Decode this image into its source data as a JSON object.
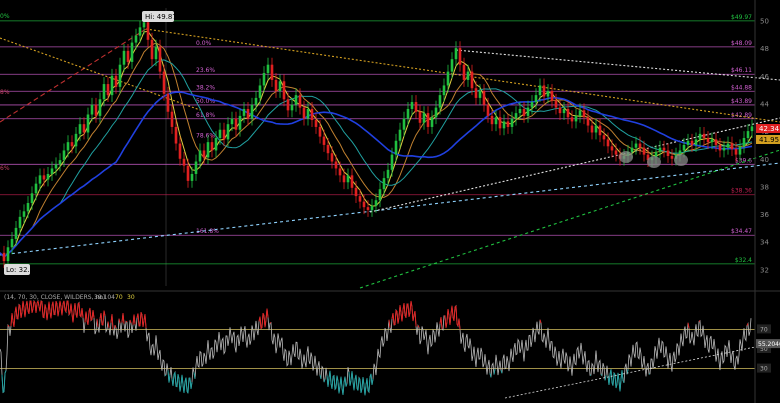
{
  "chart_data": {
    "type": "line",
    "price_panel": {
      "ylim": [
        30.8,
        50.9
      ],
      "y_ticks": [
        "50",
        "48",
        "46",
        "44",
        "42",
        "40",
        "38",
        "36",
        "34",
        "32"
      ],
      "high_label": "Hi: 49.87",
      "low_label": "Lo: 32.53",
      "last_price": "42.34",
      "last_price_2": "41.95",
      "left_pct_labels": [
        "0%",
        "8%",
        "6%"
      ],
      "horizontal_levels": [
        {
          "value": 49.97,
          "label": "$49.97",
          "color": "#20c040"
        },
        {
          "value": 48.09,
          "label": "$48.09",
          "color": "#d060d0"
        },
        {
          "value": 46.11,
          "label": "$46.11",
          "color": "#d060d0"
        },
        {
          "value": 44.88,
          "label": "$44.88",
          "color": "#d060d0"
        },
        {
          "value": 43.89,
          "label": "$43.89",
          "color": "#d060d0"
        },
        {
          "value": 42.89,
          "label": "$42.89",
          "color": "#d060d0"
        },
        {
          "value": 39.6,
          "label": "$39.6",
          "color": "#d060d0"
        },
        {
          "value": 37.4,
          "label": "$38.36",
          "color": "#c02050"
        },
        {
          "value": 34.47,
          "label": "$34.47",
          "color": "#d060d0"
        },
        {
          "value": 32.4,
          "label": "$32.4",
          "color": "#20c040"
        }
      ],
      "fib_labels": [
        {
          "value": 48.09,
          "label": "0.0%"
        },
        {
          "value": 46.11,
          "label": "23.6%"
        },
        {
          "value": 44.88,
          "label": "38.2%"
        },
        {
          "value": 43.89,
          "label": "50.0%"
        },
        {
          "value": 42.89,
          "label": "61.8%"
        },
        {
          "value": 41.4,
          "label": "78.6%"
        },
        {
          "value": 34.47,
          "label": "161.8%"
        }
      ],
      "price_series": [
        [
          0,
          33.2
        ],
        [
          4,
          32.6
        ],
        [
          8,
          33.6
        ],
        [
          12,
          34.2
        ],
        [
          16,
          35.0
        ],
        [
          20,
          35.8
        ],
        [
          24,
          36.2
        ],
        [
          28,
          36.8
        ],
        [
          32,
          37.5
        ],
        [
          36,
          38.2
        ],
        [
          40,
          38.8
        ],
        [
          44,
          38.5
        ],
        [
          48,
          38.9
        ],
        [
          52,
          39.3
        ],
        [
          56,
          39.6
        ],
        [
          60,
          39.9
        ],
        [
          64,
          40.6
        ],
        [
          68,
          41.2
        ],
        [
          72,
          40.9
        ],
        [
          76,
          41.8
        ],
        [
          80,
          42.5
        ],
        [
          84,
          41.9
        ],
        [
          88,
          43.2
        ],
        [
          92,
          43.9
        ],
        [
          96,
          43.1
        ],
        [
          100,
          44.3
        ],
        [
          104,
          45.4
        ],
        [
          108,
          44.6
        ],
        [
          112,
          46.0
        ],
        [
          116,
          45.2
        ],
        [
          120,
          46.8
        ],
        [
          124,
          47.8
        ],
        [
          128,
          47.0
        ],
        [
          132,
          48.4
        ],
        [
          136,
          48.9
        ],
        [
          140,
          49.5
        ],
        [
          144,
          49.87
        ],
        [
          148,
          48.6
        ],
        [
          152,
          47.2
        ],
        [
          156,
          48.1
        ],
        [
          160,
          46.3
        ],
        [
          164,
          44.7
        ],
        [
          168,
          43.4
        ],
        [
          172,
          42.3
        ],
        [
          176,
          41.1
        ],
        [
          180,
          40.0
        ],
        [
          184,
          39.5
        ],
        [
          188,
          38.4
        ],
        [
          192,
          38.9
        ],
        [
          196,
          39.8
        ],
        [
          200,
          40.6
        ],
        [
          204,
          40.1
        ],
        [
          208,
          41.2
        ],
        [
          212,
          40.6
        ],
        [
          216,
          41.5
        ],
        [
          220,
          42.1
        ],
        [
          224,
          41.4
        ],
        [
          228,
          42.5
        ],
        [
          232,
          42.9
        ],
        [
          236,
          42.1
        ],
        [
          240,
          43.1
        ],
        [
          244,
          43.6
        ],
        [
          248,
          42.9
        ],
        [
          252,
          43.9
        ],
        [
          256,
          44.4
        ],
        [
          260,
          45.3
        ],
        [
          264,
          46.2
        ],
        [
          268,
          46.8
        ],
        [
          272,
          45.7
        ],
        [
          276,
          44.9
        ],
        [
          280,
          45.6
        ],
        [
          284,
          44.3
        ],
        [
          288,
          43.5
        ],
        [
          292,
          43.9
        ],
        [
          296,
          44.6
        ],
        [
          300,
          43.7
        ],
        [
          304,
          42.9
        ],
        [
          308,
          43.6
        ],
        [
          312,
          42.8
        ],
        [
          316,
          42.3
        ],
        [
          320,
          41.6
        ],
        [
          324,
          41.0
        ],
        [
          328,
          40.4
        ],
        [
          332,
          39.8
        ],
        [
          336,
          39.3
        ],
        [
          340,
          38.8
        ],
        [
          344,
          38.3
        ],
        [
          348,
          38.8
        ],
        [
          352,
          37.9
        ],
        [
          356,
          37.3
        ],
        [
          360,
          36.9
        ],
        [
          364,
          36.5
        ],
        [
          368,
          36.3
        ],
        [
          372,
          36.6
        ],
        [
          376,
          37.0
        ],
        [
          380,
          37.8
        ],
        [
          384,
          38.6
        ],
        [
          388,
          39.2
        ],
        [
          392,
          40.3
        ],
        [
          396,
          41.3
        ],
        [
          400,
          42.1
        ],
        [
          404,
          42.9
        ],
        [
          408,
          43.6
        ],
        [
          412,
          44.1
        ],
        [
          416,
          43.4
        ],
        [
          420,
          42.6
        ],
        [
          424,
          43.3
        ],
        [
          428,
          42.3
        ],
        [
          432,
          43.0
        ],
        [
          436,
          43.7
        ],
        [
          440,
          44.6
        ],
        [
          444,
          45.3
        ],
        [
          448,
          46.3
        ],
        [
          452,
          47.2
        ],
        [
          456,
          48.0
        ],
        [
          460,
          46.8
        ],
        [
          464,
          45.7
        ],
        [
          468,
          46.3
        ],
        [
          472,
          45.1
        ],
        [
          476,
          44.4
        ],
        [
          480,
          44.9
        ],
        [
          484,
          43.9
        ],
        [
          488,
          43.1
        ],
        [
          492,
          42.5
        ],
        [
          496,
          43.0
        ],
        [
          500,
          42.2
        ],
        [
          504,
          42.7
        ],
        [
          508,
          42.3
        ],
        [
          512,
          42.9
        ],
        [
          516,
          43.3
        ],
        [
          520,
          43.6
        ],
        [
          524,
          43.1
        ],
        [
          528,
          43.7
        ],
        [
          532,
          44.1
        ],
        [
          536,
          44.6
        ],
        [
          540,
          45.3
        ],
        [
          544,
          44.5
        ],
        [
          548,
          44.9
        ],
        [
          552,
          44.2
        ],
        [
          556,
          43.7
        ],
        [
          560,
          43.3
        ],
        [
          564,
          43.6
        ],
        [
          568,
          43.0
        ],
        [
          572,
          42.7
        ],
        [
          576,
          43.1
        ],
        [
          580,
          43.5
        ],
        [
          584,
          43.0
        ],
        [
          588,
          42.4
        ],
        [
          592,
          41.9
        ],
        [
          596,
          42.4
        ],
        [
          600,
          41.7
        ],
        [
          604,
          41.4
        ],
        [
          608,
          40.9
        ],
        [
          612,
          40.6
        ],
        [
          616,
          40.3
        ],
        [
          620,
          40.0
        ],
        [
          624,
          40.2
        ],
        [
          628,
          40.5
        ],
        [
          632,
          40.8
        ],
        [
          636,
          41.1
        ],
        [
          640,
          40.8
        ],
        [
          644,
          40.3
        ],
        [
          648,
          39.9
        ],
        [
          652,
          40.1
        ],
        [
          656,
          40.5
        ],
        [
          660,
          40.8
        ],
        [
          664,
          40.6
        ],
        [
          668,
          40.2
        ],
        [
          672,
          40.0
        ],
        [
          676,
          40.3
        ],
        [
          680,
          40.6
        ],
        [
          684,
          41.0
        ],
        [
          688,
          41.3
        ],
        [
          692,
          41.0
        ],
        [
          696,
          41.4
        ],
        [
          700,
          41.8
        ],
        [
          704,
          41.5
        ],
        [
          708,
          41.2
        ],
        [
          712,
          41.4
        ],
        [
          716,
          41.0
        ],
        [
          720,
          40.6
        ],
        [
          724,
          40.8
        ],
        [
          728,
          41.1
        ],
        [
          732,
          40.7
        ],
        [
          736,
          40.3
        ],
        [
          740,
          40.9
        ],
        [
          744,
          41.5
        ],
        [
          748,
          42.0
        ],
        [
          752,
          42.34
        ]
      ]
    },
    "rsi_panel": {
      "header": "(14, 70, 30, CLOSE, WILDERS, no)",
      "value_text": "39.104",
      "level_70": "70",
      "level_30": "30",
      "ylim": [
        0,
        100
      ],
      "y_ticks": [
        "70",
        "50",
        "30"
      ],
      "current_value": "55.2046"
    }
  }
}
